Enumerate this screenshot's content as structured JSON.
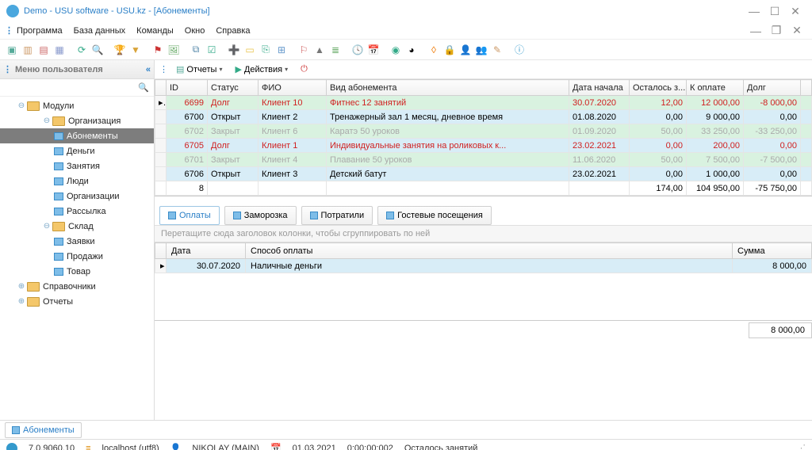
{
  "title": "Demo - USU software - USU.kz - [Абонементы]",
  "menu": {
    "items": [
      "Программа",
      "База данных",
      "Команды",
      "Окно",
      "Справка"
    ]
  },
  "sidebar": {
    "header": "Меню пользователя",
    "items": [
      {
        "label": "Модули"
      },
      {
        "label": "Организация"
      },
      {
        "label": "Абонементы"
      },
      {
        "label": "Деньги"
      },
      {
        "label": "Занятия"
      },
      {
        "label": "Люди"
      },
      {
        "label": "Организации"
      },
      {
        "label": "Рассылка"
      },
      {
        "label": "Склад"
      },
      {
        "label": "Заявки"
      },
      {
        "label": "Продажи"
      },
      {
        "label": "Товар"
      },
      {
        "label": "Справочники"
      },
      {
        "label": "Отчеты"
      }
    ]
  },
  "ctoolbar": {
    "reports": "Отчеты",
    "actions": "Действия"
  },
  "grid": {
    "headers": [
      "ID",
      "Статус",
      "ФИО",
      "Вид абонемента",
      "Дата начала",
      "Осталось з...",
      "К оплате",
      "Долг"
    ],
    "rows": [
      {
        "id": "6699",
        "status": "Долг",
        "fio": "Клиент 10",
        "type": "Фитнес 12 занятий",
        "date": "30.07.2020",
        "left": "12,00",
        "pay": "12 000,00",
        "debt": "-8 000,00",
        "cls": "green red"
      },
      {
        "id": "6700",
        "status": "Открыт",
        "fio": "Клиент 2",
        "type": "Тренажерный зал 1 месяц, дневное время",
        "date": "01.08.2020",
        "left": "0,00",
        "pay": "9 000,00",
        "debt": "0,00",
        "cls": "blue"
      },
      {
        "id": "6702",
        "status": "Закрыт",
        "fio": "Клиент 6",
        "type": "Каратэ 50 уроков",
        "date": "01.09.2020",
        "left": "50,00",
        "pay": "33 250,00",
        "debt": "-33 250,00",
        "cls": "green gray"
      },
      {
        "id": "6705",
        "status": "Долг",
        "fio": "Клиент 1",
        "type": "Индивидуальные занятия на роликовых к...",
        "date": "23.02.2021",
        "left": "0,00",
        "pay": "200,00",
        "debt": "0,00",
        "cls": "blue red"
      },
      {
        "id": "6701",
        "status": "Закрыт",
        "fio": "Клиент 4",
        "type": "Плавание 50 уроков",
        "date": "11.06.2020",
        "left": "50,00",
        "pay": "7 500,00",
        "debt": "-7 500,00",
        "cls": "green gray"
      },
      {
        "id": "6706",
        "status": "Открыт",
        "fio": "Клиент 3",
        "type": "Детский батут",
        "date": "23.02.2021",
        "left": "0,00",
        "pay": "1 000,00",
        "debt": "0,00",
        "cls": "blue"
      }
    ],
    "footer": {
      "count": "8",
      "left": "174,00",
      "pay": "104 950,00",
      "debt": "-75 750,00"
    }
  },
  "tabs": {
    "items": [
      "Оплаты",
      "Заморозка",
      "Потратили",
      "Гостевые посещения"
    ]
  },
  "subpanel": {
    "hint": "Перетащите сюда заголовок колонки, чтобы сгруппировать по ней",
    "headers": [
      "Дата",
      "Способ оплаты",
      "Сумма"
    ],
    "row": {
      "date": "30.07.2020",
      "method": "Наличные деньги",
      "sum": "8 000,00"
    },
    "footer_sum": "8 000,00"
  },
  "doctab": "Абонементы",
  "status": {
    "version": "7.0.9060.10",
    "host": "localhost (utf8)",
    "user": "NIKOLAY (MAIN)",
    "date": "01.03.2021",
    "time": "0:00:00:002",
    "extra": "Осталось занятий"
  }
}
